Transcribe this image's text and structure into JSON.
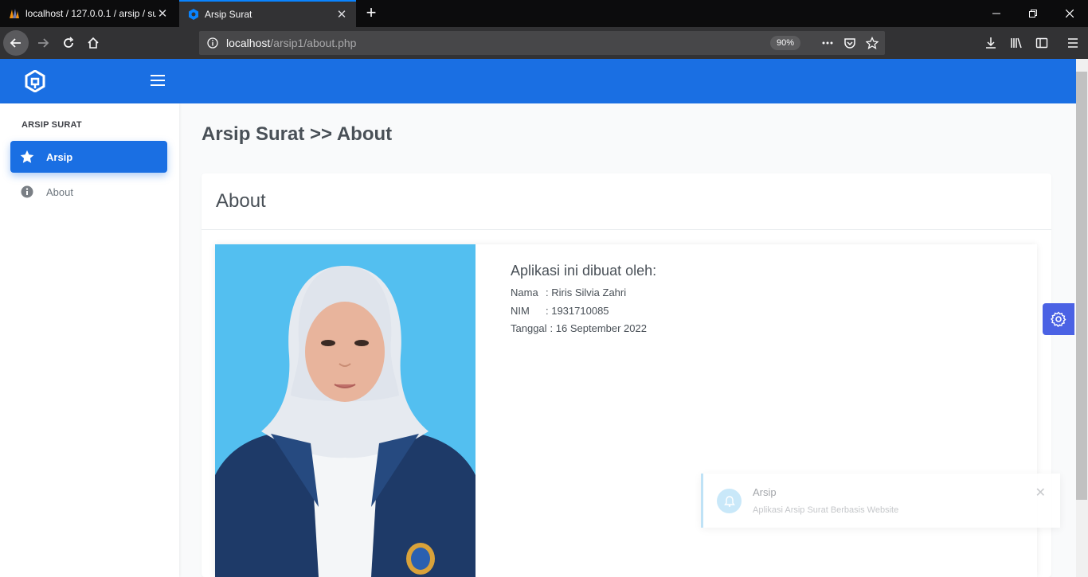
{
  "browser": {
    "tabs": [
      {
        "title": "localhost / 127.0.0.1 / arsip / surat"
      },
      {
        "title": "Arsip Surat"
      }
    ],
    "url_host": "localhost",
    "url_path": "/arsip1/about.php",
    "zoom": "90%"
  },
  "sidebar": {
    "heading": "ARSIP SURAT",
    "items": [
      {
        "label": "Arsip",
        "icon": "star-icon",
        "active": true
      },
      {
        "label": "About",
        "icon": "info-icon",
        "active": false
      }
    ]
  },
  "main": {
    "page_title": "Arsip Surat >> About",
    "card_title": "About",
    "info": {
      "title": "Aplikasi ini dibuat oleh:",
      "rows": [
        {
          "key": "Nama",
          "value": ": Riris Silvia Zahri"
        },
        {
          "key": "NIM",
          "value": ": 1931710085"
        },
        {
          "key": "Tanggal",
          "value": ": 16 September 2022"
        }
      ]
    }
  },
  "toast": {
    "title": "Arsip",
    "message": "Aplikasi Arsip Surat Berbasis Website"
  },
  "colors": {
    "primary": "#1a6fe3",
    "settings_button": "#4b62e4",
    "photo_background": "#53bff0"
  }
}
